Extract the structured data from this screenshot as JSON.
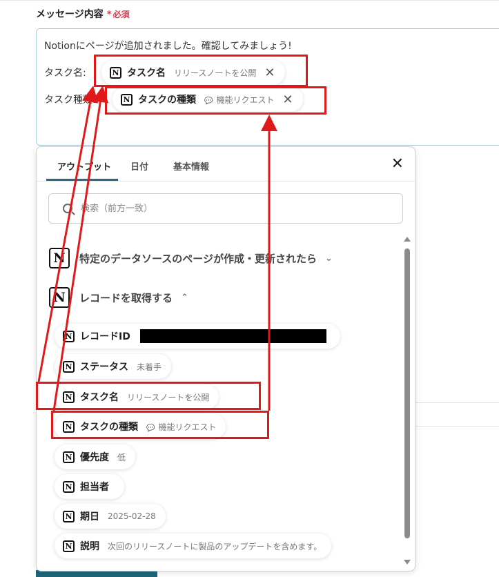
{
  "field": {
    "label": "メッセージ内容",
    "required_star": "*",
    "required_text": "必須"
  },
  "message": {
    "line1": "Notionにページが追加されました。確認してみましょう!",
    "task_name_label": "タスク名:",
    "task_type_label": "タスク種類:"
  },
  "inserted_pills": {
    "task_name": {
      "label": "タスク名",
      "value": "リリースノートを公開"
    },
    "task_type": {
      "label": "タスクの種類",
      "value": "機能リクエスト"
    }
  },
  "panel": {
    "tabs": [
      "アウトプット",
      "日付",
      "基本情報"
    ],
    "active_tab": "アウトプット",
    "search_placeholder": "検索（前方一致）",
    "sections": [
      {
        "title": "特定のデータソースのページが作成・更新されたら",
        "chevron": "down"
      },
      {
        "title": "レコードを取得する",
        "chevron": "up"
      }
    ],
    "items": [
      {
        "label": "レコードID",
        "value": ""
      },
      {
        "label": "ステータス",
        "value": "未着手"
      },
      {
        "label": "タスク名",
        "value": "リリースノートを公開"
      },
      {
        "label": "タスクの種類",
        "value": "機能リクエスト"
      },
      {
        "label": "優先度",
        "value": "低"
      },
      {
        "label": "担当者",
        "value": ""
      },
      {
        "label": "期日",
        "value": "2025-02-28"
      },
      {
        "label": "説明",
        "value": "次回のリリースノートに製品のアップデートを含めます。"
      }
    ]
  },
  "icons": {
    "notion": "notion-logo-icon",
    "close": "close-icon",
    "search": "search-icon",
    "chevron_down": "chevron-down-icon",
    "chevron_up": "chevron-up-icon",
    "speech_bubble": "speech-bubble-icon"
  },
  "colors": {
    "required": "#e2384d",
    "annotation_red": "#e01a1a",
    "tab_underline": "#2a6a82",
    "input_border": "#a9cfe0"
  }
}
